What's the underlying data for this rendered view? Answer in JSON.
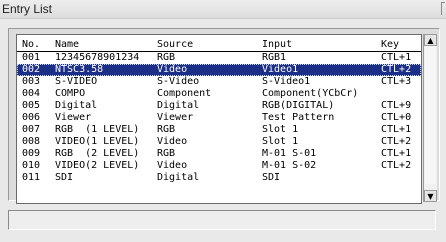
{
  "window": {
    "title": "Entry List"
  },
  "list": {
    "headers": {
      "no": "No.",
      "name": "Name",
      "source": "Source",
      "input": "Input",
      "key": "Key"
    },
    "rows": [
      {
        "no": "001",
        "name": "12345678901234",
        "source": "RGB",
        "input": "RGB1",
        "key": "CTL+1"
      },
      {
        "no": "002",
        "name": "NTSC3.58",
        "source": "Video",
        "input": "Video1",
        "key": "CTL+2"
      },
      {
        "no": "003",
        "name": "S-VIDEO",
        "source": "S-Video",
        "input": "S-Video1",
        "key": "CTL+3"
      },
      {
        "no": "004",
        "name": "COMPO",
        "source": "Component",
        "input": "Component(YCbCr)",
        "key": ""
      },
      {
        "no": "005",
        "name": "Digital",
        "source": "Digital",
        "input": "RGB(DIGITAL)",
        "key": "CTL+9"
      },
      {
        "no": "006",
        "name": "Viewer",
        "source": "Viewer",
        "input": "Test Pattern",
        "key": "CTL+0"
      },
      {
        "no": "007",
        "name": "RGB  (1 LEVEL)",
        "source": "RGB",
        "input": "Slot 1",
        "key": "CTL+1"
      },
      {
        "no": "008",
        "name": "VIDEO(1 LEVEL)",
        "source": "Video",
        "input": "Slot 1",
        "key": "CTL+2"
      },
      {
        "no": "009",
        "name": "RGB  (2 LEVEL)",
        "source": "RGB",
        "input": "M-01 S-01",
        "key": "CTL+1"
      },
      {
        "no": "010",
        "name": "VIDEO(2 LEVEL)",
        "source": "Video",
        "input": "M-01 S-02",
        "key": "CTL+2"
      },
      {
        "no": "011",
        "name": "SDI",
        "source": "Digital",
        "input": "SDI",
        "key": ""
      }
    ],
    "selected_no": "002"
  },
  "scrollbar": {
    "up_icon": "▲",
    "down_icon": "▼"
  },
  "colors": {
    "selection": "#1c2f86"
  }
}
